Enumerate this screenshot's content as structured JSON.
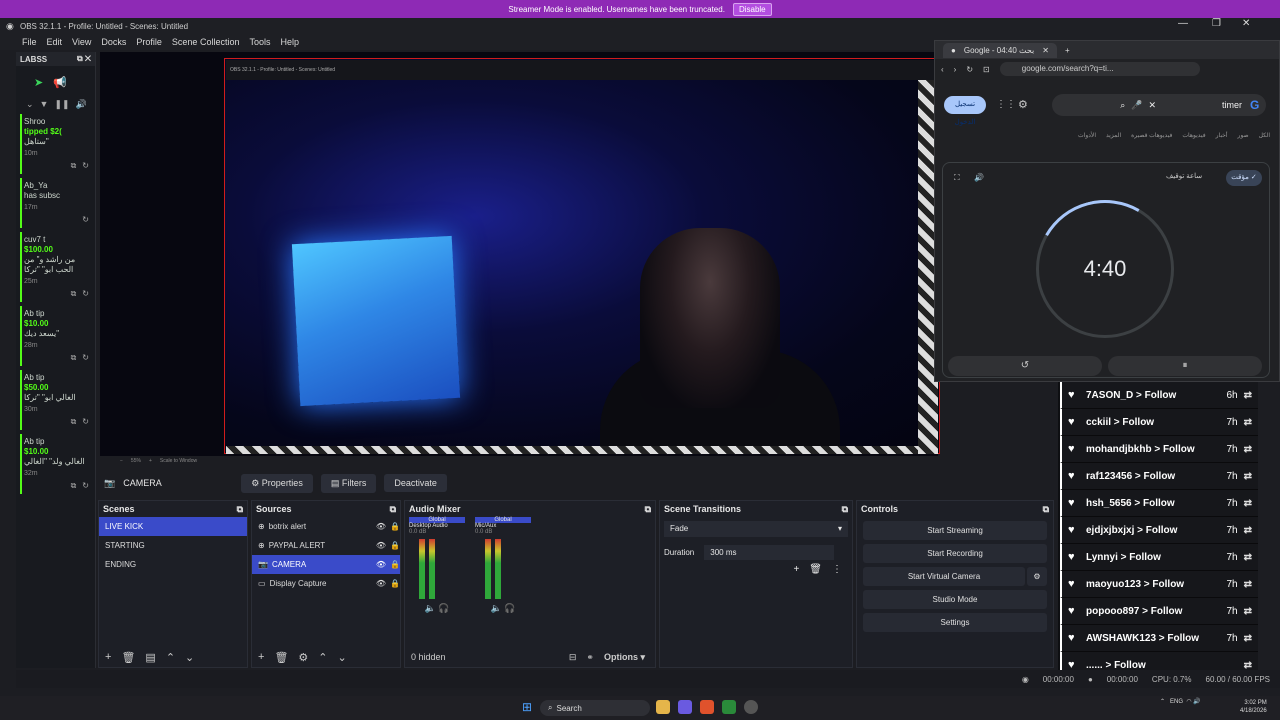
{
  "banner": {
    "text": "Streamer Mode is enabled. Usernames have been truncated.",
    "button": "Disable"
  },
  "window": {
    "title": "OBS 32.1.1 - Profile: Untitled - Scenes: Untitled"
  },
  "menu": [
    "File",
    "Edit",
    "View",
    "Docks",
    "Profile",
    "Scene Collection",
    "Tools",
    "Help"
  ],
  "left_dock": {
    "title": "LABSS",
    "items": [
      {
        "user": "Shroo",
        "line": "tipped $2(",
        "msg": "ستاهل\"",
        "time": "10m"
      },
      {
        "user": "Ab_Ya",
        "line": "has subsc",
        "msg": "",
        "time": "17m"
      },
      {
        "user": "cuv7 t",
        "amount": "$100.00",
        "msg": "من راشد و\" من الحب ابو\" \"تركا",
        "time": "25m"
      },
      {
        "user": "Ab tip",
        "amount": "$10.00",
        "msg": "يسعد ديك\"",
        "time": "28m"
      },
      {
        "user": "Ab tip",
        "amount": "$50.00",
        "msg": "الغالي ابو\" \"تركا",
        "time": "30m"
      },
      {
        "user": "Ab tip",
        "amount": "$10.00",
        "msg": "الغالي ولد\" \"الغالي",
        "time": "32m"
      }
    ]
  },
  "preview": {
    "zoom": "55%",
    "scale_label": "Scale to Window"
  },
  "browser": {
    "tab_title": "Google - بحث 04:40",
    "url": "google.com/search?q=ti...",
    "search_query": "timer",
    "signin": "تسجيل الدخول",
    "google_tabs": [
      "الكل",
      "صور",
      "أخبار",
      "فيديوهات",
      "فيديوهات قصيرة",
      "المزيد",
      "الأدوات"
    ],
    "chip_timer": "مؤقت ✓",
    "chip_stopwatch": "ساعة توقيف",
    "time": "4:40",
    "reset_icon": "↺",
    "pause_icon": "⏸"
  },
  "follows": [
    {
      "name": "7ASON_D > Follow",
      "ago": "6h"
    },
    {
      "name": "cckiil > Follow",
      "ago": "7h"
    },
    {
      "name": "mohandjbkhb > Follow",
      "ago": "7h"
    },
    {
      "name": "raf123456 > Follow",
      "ago": "7h"
    },
    {
      "name": "hsh_5656 > Follow",
      "ago": "7h"
    },
    {
      "name": "ejdjxjbxjxj > Follow",
      "ago": "7h"
    },
    {
      "name": "Lynnyi > Follow",
      "ago": "7h"
    },
    {
      "name": "maoyuo123 > Follow",
      "ago": "7h"
    },
    {
      "name": "popooo897 > Follow",
      "ago": "7h"
    },
    {
      "name": "AWSHAWK123 > Follow",
      "ago": "7h"
    },
    {
      "name": "...... > Follow",
      "ago": ""
    }
  ],
  "source_toolbar": {
    "source": "CAMERA",
    "properties": "Properties",
    "filters": "Filters",
    "deactivate": "Deactivate"
  },
  "scenes": {
    "title": "Scenes",
    "items": [
      "LIVE KICK",
      "STARTING",
      "ENDING"
    ],
    "selected": 0
  },
  "sources": {
    "title": "Sources",
    "items": [
      "botrix alert",
      "PAYPAL ALERT",
      "CAMERA",
      "Display Capture"
    ],
    "selected": 2
  },
  "audio": {
    "title": "Audio Mixer",
    "channels": [
      {
        "badge": "Global",
        "name": "Desktop Audio",
        "db": "0.0 dB"
      },
      {
        "badge": "Global",
        "name": "Mic/Aux",
        "db": "0.0 dB"
      }
    ],
    "hidden": "0 hidden",
    "options": "Options"
  },
  "transitions": {
    "title": "Scene Transitions",
    "type": "Fade",
    "duration_label": "Duration",
    "duration": "300 ms"
  },
  "controls": {
    "title": "Controls",
    "buttons": [
      "Start Streaming",
      "Start Recording",
      "Start Virtual Camera",
      "Studio Mode",
      "Settings"
    ]
  },
  "status": {
    "stream_time": "00:00:00",
    "rec_time": "00:00:00",
    "cpu": "CPU: 0.7%",
    "fps": "60.00 / 60.00 FPS"
  },
  "taskbar": {
    "search": "Search",
    "lang": "ENG",
    "time": "3:02 PM",
    "date": "4/18/2026"
  },
  "colors": {
    "banner": "#8e2ab5",
    "selection": "#3a4bc9",
    "kick_green": "#53fc18"
  }
}
